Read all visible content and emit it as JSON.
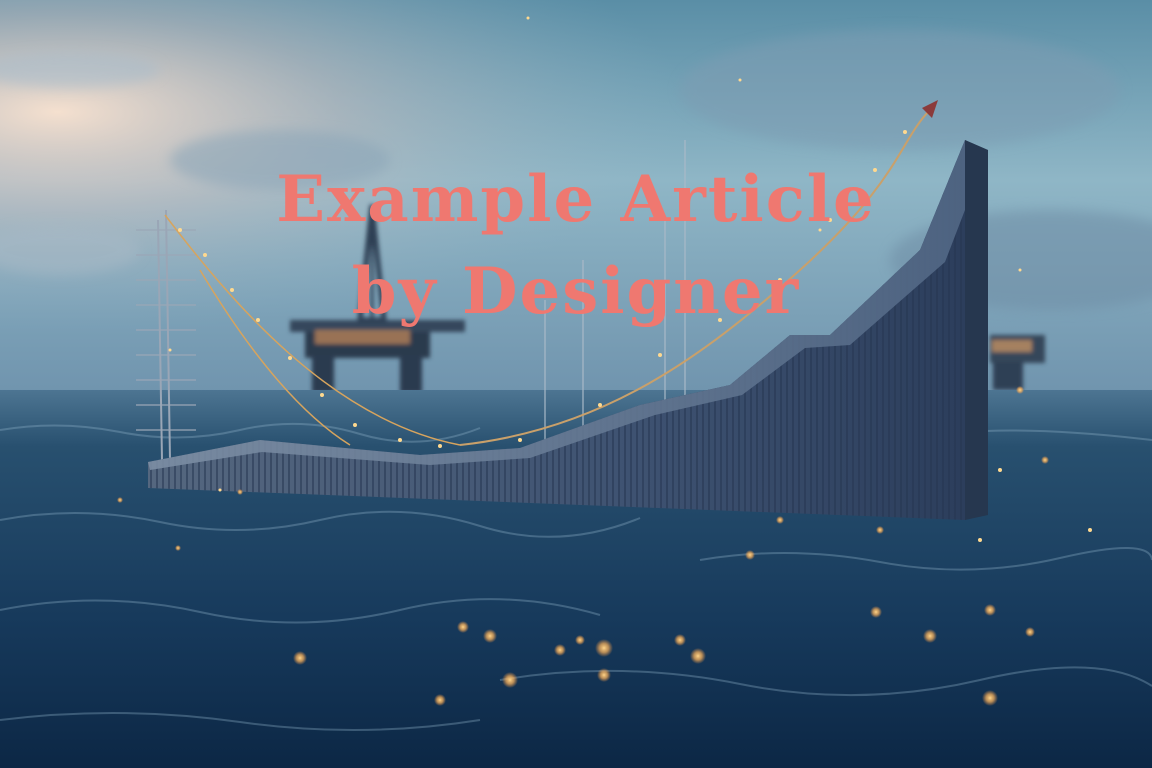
{
  "headline": {
    "line1": "Example Article",
    "line2": "by Designer"
  },
  "colors": {
    "headline": "#ef7870",
    "sky_top": "#5e93a8",
    "sky_glow": "#f3d7c6",
    "sea": "#14375a",
    "lights": "#ffc66a",
    "chart_face": "#3b5070"
  },
  "scene": {
    "chart_trend": "rising",
    "elements": [
      "offshore-rig",
      "rising-chart-wall",
      "trend-arrow",
      "measurement-mast",
      "light-string"
    ]
  }
}
